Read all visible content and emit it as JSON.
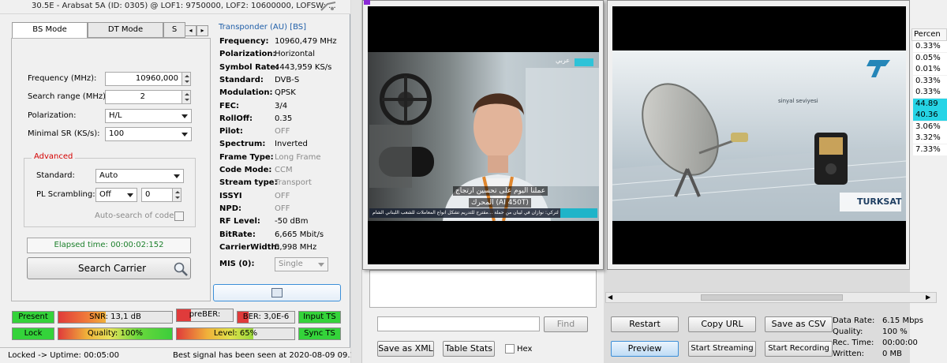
{
  "window": {
    "title": "30.5E - Arabsat 5A (ID: 0305) @ LOF1: 9750000, LOF2: 10600000, LOFSW: ..."
  },
  "tabs": [
    "BS Mode",
    "DT Mode",
    "S"
  ],
  "scan": {
    "frequency_label": "Frequency (MHz):",
    "frequency_value": "10960,000",
    "search_range_label": "Search range (MHz):",
    "search_range_value": "2",
    "polarization_label": "Polarization:",
    "polarization_value": "H/L",
    "min_sr_label": "Minimal SR (KS/s):",
    "min_sr_value": "100"
  },
  "advanced": {
    "title": "Advanced",
    "standard_label": "Standard:",
    "standard_value": "Auto",
    "pl_scrambling_label": "PL Scrambling:",
    "pl_scrambling_value": "Off",
    "pl_scrambling_number": "0",
    "auto_search_label": "Auto-search of code"
  },
  "elapsed": "Elapsed time: 00:00:02:152",
  "search_button": "Search Carrier",
  "transponder": {
    "title": "Transponder (AU) [BS]",
    "rows": [
      {
        "label": "Frequency:",
        "value": "10960,479 MHz",
        "dim": false
      },
      {
        "label": "Polarization:",
        "value": "Horizontal",
        "dim": false
      },
      {
        "label": "Symbol Rate:",
        "value": "4443,959 KS/s",
        "dim": false
      },
      {
        "label": "Standard:",
        "value": "DVB-S",
        "dim": false
      },
      {
        "label": "Modulation:",
        "value": "QPSK",
        "dim": false
      },
      {
        "label": "FEC:",
        "value": "3/4",
        "dim": false
      },
      {
        "label": "RollOff:",
        "value": "0.35",
        "dim": false
      },
      {
        "label": "Pilot:",
        "value": "OFF",
        "dim": true
      },
      {
        "label": "Spectrum:",
        "value": "Inverted",
        "dim": false
      },
      {
        "label": "Frame Type:",
        "value": "Long Frame",
        "dim": true
      },
      {
        "label": "Code Mode:",
        "value": "CCM",
        "dim": true
      },
      {
        "label": "Stream type:",
        "value": "Transport",
        "dim": true
      },
      {
        "label": "ISSYI",
        "value": "OFF",
        "dim": true
      },
      {
        "label": "NPD:",
        "value": "OFF",
        "dim": true
      },
      {
        "label": "RF Level:",
        "value": "-50 dBm",
        "dim": false
      },
      {
        "label": "BitRate:",
        "value": "6,665 Mbit/s",
        "dim": false
      },
      {
        "label": "CarrierWidth:",
        "value": "5,998 MHz",
        "dim": false
      }
    ],
    "mis_label": "MIS (0):",
    "mis_value": "Single"
  },
  "indicators": {
    "present": "Present",
    "snr": "SNR: 13,1 dB",
    "snr_level": 0.42,
    "preber": "preBER: 3,0E...",
    "ber": "BER: 3,0E-6",
    "input_ts": "Input TS",
    "lock": "Lock",
    "quality": "Quality: 100%",
    "quality_level": 1.0,
    "level": "Level: 65%",
    "level_level": 0.65,
    "sync_ts": "Sync TS"
  },
  "status": {
    "locked": "Locked -> Uptime: 00:05:00",
    "best_signal": "Best signal has been seen at 2020-08-09 09.1"
  },
  "mid_panel": {
    "find_button": "Find",
    "save_xml": "Save as XML",
    "table_stats": "Table Stats",
    "hex_label": "Hex"
  },
  "video1": {
    "channel_logo": "عربي",
    "caption_line1": "عملنا اليوم على تحسين ارتجاج",
    "caption_line2": "المحرك (AI 450T)",
    "ticker": "نائب الرئيس التركي: نوازان في ليبان من حملة ...مقترح للتدريم تشكل انواع المعاملات للشعب اللبناني الشام"
  },
  "video2": {
    "brand": "TURKSAT",
    "caption": "sinyal seviyesi"
  },
  "right_column": {
    "header": "Percen",
    "values": [
      "0.33%",
      "0.05%",
      "0.01%",
      "0.33%",
      "0.33%",
      "44.89",
      "40.36",
      "3.06%",
      "3.32%",
      "7.33%"
    ],
    "highlighted": [
      5,
      6
    ]
  },
  "controls": {
    "restart": "Restart",
    "copy_url": "Copy URL",
    "save_csv": "Save as CSV",
    "preview": "Preview",
    "start_streaming": "Start Streaming",
    "start_recording": "Start Recording"
  },
  "stats": {
    "data_rate_label": "Data Rate:",
    "data_rate_value": "6.15 Mbps",
    "quality_label": "Quality:",
    "quality_value": "100 %",
    "rec_time_label": "Rec. Time:",
    "rec_time_value": "00:00:00",
    "written_label": "Written:",
    "written_value": "0 MB"
  },
  "colors": {
    "accent": "#1f5ea8",
    "indicator_green": "#34d33a",
    "advanced_title": "#d40000",
    "highlight": "#26d4e6"
  }
}
